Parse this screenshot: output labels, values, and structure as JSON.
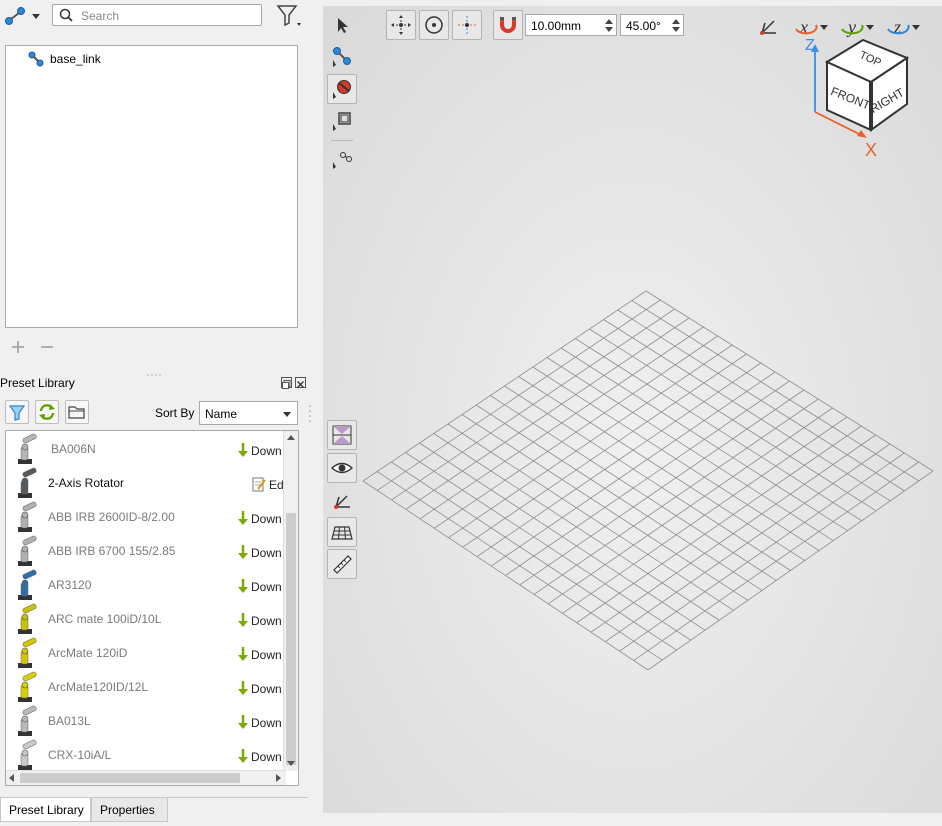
{
  "search": {
    "placeholder": "Search"
  },
  "tree": {
    "items": [
      {
        "label": "base_link"
      }
    ]
  },
  "preset_library": {
    "title": "Preset Library",
    "sort_label": "Sort By",
    "sort_value": "Name",
    "items": [
      {
        "name": "BA006N",
        "action": "Down",
        "action_icon": "download-arrow-icon",
        "installed": false
      },
      {
        "name": "2-Axis Rotator",
        "action": "Ed",
        "action_icon": "edit-icon",
        "installed": true
      },
      {
        "name": "ABB IRB 2600ID-8/2.00",
        "action": "Down",
        "action_icon": "download-arrow-icon",
        "installed": false
      },
      {
        "name": "ABB IRB 6700 155/2.85",
        "action": "Down",
        "action_icon": "download-arrow-icon",
        "installed": false
      },
      {
        "name": "AR3120",
        "action": "Down",
        "action_icon": "download-arrow-icon",
        "installed": false
      },
      {
        "name": "ARC mate 100iD/10L",
        "action": "Down",
        "action_icon": "download-arrow-icon",
        "installed": false
      },
      {
        "name": "ArcMate 120iD",
        "action": "Down",
        "action_icon": "download-arrow-icon",
        "installed": false
      },
      {
        "name": "ArcMate120ID/12L",
        "action": "Down",
        "action_icon": "download-arrow-icon",
        "installed": false
      },
      {
        "name": "BA013L",
        "action": "Down",
        "action_icon": "download-arrow-icon",
        "installed": false
      },
      {
        "name": "CRX-10iA/L",
        "action": "Down",
        "action_icon": "download-arrow-icon",
        "installed": false
      }
    ]
  },
  "bottom_tabs": [
    {
      "label": "Preset Library",
      "active": true
    },
    {
      "label": "Properties",
      "active": false
    }
  ],
  "viewport": {
    "step_distance": "10.00mm",
    "step_angle": "45.00°",
    "view_cube": {
      "top": "TOP",
      "front": "FRONT",
      "right": "RIGHT"
    },
    "axes": {
      "z": "Z",
      "x": "X"
    }
  },
  "colors": {
    "accent_blue": "#2e86d9",
    "x_axis": "#e8622c",
    "z_axis": "#3a8ee6",
    "grid_line": "#8a8a8a",
    "download_green": "#7fa800"
  }
}
